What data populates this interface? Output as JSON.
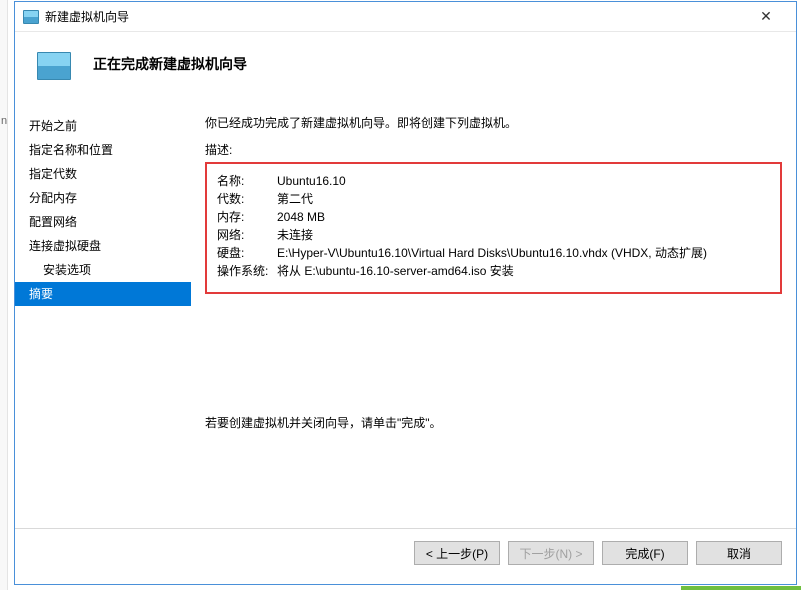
{
  "titlebar": {
    "title": "新建虚拟机向导"
  },
  "header": {
    "title": "正在完成新建虚拟机向导"
  },
  "sidebar": {
    "items": [
      {
        "label": "开始之前",
        "indent": false
      },
      {
        "label": "指定名称和位置",
        "indent": false
      },
      {
        "label": "指定代数",
        "indent": false
      },
      {
        "label": "分配内存",
        "indent": false
      },
      {
        "label": "配置网络",
        "indent": false
      },
      {
        "label": "连接虚拟硬盘",
        "indent": false
      },
      {
        "label": "安装选项",
        "indent": true
      },
      {
        "label": "摘要",
        "indent": false,
        "selected": true
      }
    ],
    "stripe_mark": "n"
  },
  "content": {
    "intro": "你已经成功完成了新建虚拟机向导。即将创建下列虚拟机。",
    "desc_label": "描述:",
    "rows": [
      {
        "key": "名称:",
        "val": "Ubuntu16.10"
      },
      {
        "key": "代数:",
        "val": "第二代"
      },
      {
        "key": "内存:",
        "val": "2048 MB"
      },
      {
        "key": "网络:",
        "val": "未连接"
      },
      {
        "key": "硬盘:",
        "val": "E:\\Hyper-V\\Ubuntu16.10\\Virtual Hard Disks\\Ubuntu16.10.vhdx (VHDX, 动态扩展)"
      },
      {
        "key": "操作系统:",
        "val": "将从 E:\\ubuntu-16.10-server-amd64.iso 安装"
      }
    ],
    "footer_text": "若要创建虚拟机并关闭向导，请单击\"完成\"。"
  },
  "buttons": {
    "prev": "< 上一步(P)",
    "next": "下一步(N) >",
    "finish": "完成(F)",
    "cancel": "取消"
  }
}
